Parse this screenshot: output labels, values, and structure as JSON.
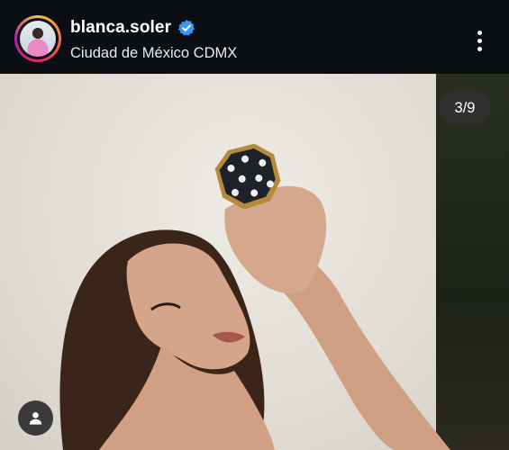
{
  "post_header": {
    "username": "blanca.soler",
    "location": "Ciudad de México CDMX"
  },
  "photo": {
    "counter": "3/9"
  },
  "icons": {
    "verified": "verified-badge-icon",
    "more": "more-vertical-icon",
    "tags": "user-tag-icon"
  },
  "colors": {
    "background": "#0b0f14",
    "verified_badge": "#3897f0",
    "counter_pill": "#323232"
  }
}
